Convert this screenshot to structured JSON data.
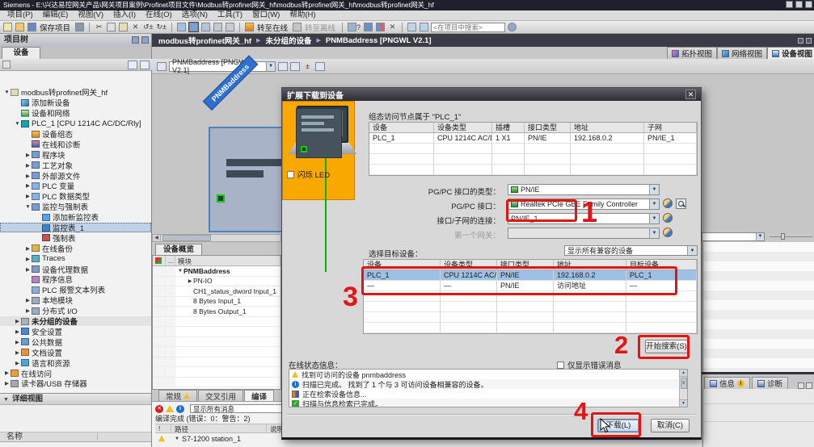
{
  "window": {
    "title": "Siemens  -  E:\\兴达易控网关产品\\网关项目案例\\Profinet项目文件\\Modbus转profinet网关_hf\\modbus转profinet网关_hf\\modbus转profinet网关_hf"
  },
  "menu_bar": {
    "items": [
      "项目(P)",
      "编辑(E)",
      "视图(V)",
      "插入(I)",
      "在线(O)",
      "选项(N)",
      "工具(T)",
      "窗口(W)",
      "帮助(H)"
    ]
  },
  "toolbar": {
    "save_label": "保存项目",
    "go_online_label": "转至在线",
    "go_offline_label": "转至离线",
    "search_placeholder": "<在项目中搜索>"
  },
  "breadcrumb": {
    "items": [
      "modbus转profinet网关_hf",
      "未分组的设备",
      "PNMBaddress [PNGWL V2.1]"
    ]
  },
  "project_tree": {
    "header": "项目树",
    "tab_label": "设备",
    "items": [
      {
        "arrow": "expanded",
        "icon": "project",
        "label": "modbus转profinet网关_hf",
        "depth": 0
      },
      {
        "arrow": "",
        "icon": "add-device",
        "label": "添加新设备",
        "depth": 1
      },
      {
        "arrow": "",
        "icon": "network",
        "label": "设备和网络",
        "depth": 1
      },
      {
        "arrow": "expanded",
        "icon": "plc",
        "label": "PLC_1 [CPU 1214C AC/DC/Rly]",
        "depth": 1
      },
      {
        "arrow": "",
        "icon": "config",
        "label": "设备组态",
        "depth": 2
      },
      {
        "arrow": "",
        "icon": "diagnostics",
        "label": "在线和诊断",
        "depth": 2
      },
      {
        "arrow": "collapsed",
        "icon": "folder",
        "label": "程序块",
        "depth": 2
      },
      {
        "arrow": "collapsed",
        "icon": "folder-tech",
        "label": "工艺对象",
        "depth": 2
      },
      {
        "arrow": "collapsed",
        "icon": "folder-src",
        "label": "外部源文件",
        "depth": 2
      },
      {
        "arrow": "collapsed",
        "icon": "tags",
        "label": "PLC 变量",
        "depth": 2
      },
      {
        "arrow": "collapsed",
        "icon": "types",
        "label": "PLC 数据类型",
        "depth": 2
      },
      {
        "arrow": "expanded",
        "icon": "folder-watch",
        "label": "监控与强制表",
        "depth": 2
      },
      {
        "arrow": "",
        "icon": "add-watch",
        "label": "添加新监控表",
        "depth": 3
      },
      {
        "arrow": "",
        "icon": "watch",
        "label": "监控表_1",
        "depth": 3,
        "selected": true
      },
      {
        "arrow": "",
        "icon": "force",
        "label": "强制表",
        "depth": 3
      },
      {
        "arrow": "collapsed",
        "icon": "backup",
        "label": "在线备份",
        "depth": 2
      },
      {
        "arrow": "collapsed",
        "icon": "traces",
        "label": "Traces",
        "depth": 2
      },
      {
        "arrow": "collapsed",
        "icon": "proxy",
        "label": "设备代理数据",
        "depth": 2
      },
      {
        "arrow": "",
        "icon": "program-info",
        "label": "程序信息",
        "depth": 2
      },
      {
        "arrow": "",
        "icon": "alarm-text",
        "label": "PLC 报警文本列表",
        "depth": 2
      },
      {
        "arrow": "collapsed",
        "icon": "local-modules",
        "label": "本地模块",
        "depth": 2
      },
      {
        "arrow": "collapsed",
        "icon": "distributed-io",
        "label": "分布式 I/O",
        "depth": 2
      },
      {
        "arrow": "collapsed",
        "icon": "ungrouped",
        "label": "未分组的设备",
        "depth": 1,
        "bold": true
      },
      {
        "arrow": "collapsed",
        "icon": "security",
        "label": "安全设置",
        "depth": 1
      },
      {
        "arrow": "collapsed",
        "icon": "common-data",
        "label": "公共数据",
        "depth": 1
      },
      {
        "arrow": "collapsed",
        "icon": "doc-settings",
        "label": "文档设置",
        "depth": 1
      },
      {
        "arrow": "collapsed",
        "icon": "languages",
        "label": "语言和资源",
        "depth": 1
      },
      {
        "arrow": "collapsed",
        "icon": "online-access",
        "label": "在线访问",
        "depth": 0
      },
      {
        "arrow": "collapsed",
        "icon": "card-reader",
        "label": "读卡器/USB 存储器",
        "depth": 0
      }
    ]
  },
  "detail_view": {
    "header": "详细视图",
    "name_column": "名称"
  },
  "editor": {
    "view_tabs": [
      "拓扑视图",
      "网络视图",
      "设备视图"
    ],
    "device_selector": "PNMBaddress [PNGWL V2.1]",
    "canvas_device_label": "PNMBaddress",
    "overview": {
      "tab_label": "设备概览",
      "module_column": "模块",
      "rows": [
        {
          "arrow": "expanded",
          "indent": 0,
          "label": "PNMBaddress",
          "bold": true
        },
        {
          "arrow": "collapsed",
          "indent": 1,
          "label": "PN-IO"
        },
        {
          "arrow": "",
          "indent": 1,
          "label": "CH1_status_dword Input_1"
        },
        {
          "arrow": "",
          "indent": 1,
          "label": "8 Bytes Input_1"
        },
        {
          "arrow": "",
          "indent": 1,
          "label": "8 Bytes Output_1"
        }
      ]
    }
  },
  "inspector": {
    "tabs": [
      "常规",
      "交叉引用",
      "编译"
    ],
    "filter_value": "显示所有消息",
    "status_text": "编译完成 (错误：0：警告：2)",
    "flag_column": "!",
    "path_column": "路径",
    "desc_column": "说明",
    "compile_row": "S7-1200 station_1"
  },
  "right_panel": {
    "info_tab": "信息",
    "diagnostics_tab": "诊断"
  },
  "dialog": {
    "title": "扩展下载到设备",
    "config_node_text": "组态访问节点属于 \"PLC_1\"",
    "configured_table": {
      "headers": [
        "设备",
        "设备类型",
        "插槽",
        "接口类型",
        "地址",
        "子网"
      ],
      "rows": [
        [
          "PLC_1",
          "CPU 1214C AC/D...",
          "1 X1",
          "PN/IE",
          "192.168.0.2",
          "PN/IE_1"
        ]
      ]
    },
    "pgpc_type_label": "PG/PC 接口的类型：",
    "pgpc_type_value": "PN/IE",
    "pgpc_if_label": "PG/PC 接口：",
    "pgpc_if_value": "Realtek PCIe GBE Family Controller",
    "subnet_label": "接口/子网的连接：",
    "subnet_value": "PN/IE_1",
    "gateway_label": "第一个网关：",
    "target_label": "选择目标设备：",
    "compat_filter_value": "显示所有兼容的设备",
    "target_table": {
      "headers": [
        "设备",
        "设备类型",
        "接口类型",
        "地址",
        "目标设备"
      ],
      "rows": [
        {
          "cells": [
            "PLC_1",
            "CPU 1214C AC/D...",
            "PN/IE",
            "192.168.0.2",
            "PLC_1"
          ],
          "selected": true
        },
        {
          "cells": [
            "—",
            "—",
            "PN/IE",
            "访问地址",
            "—"
          ],
          "selected": false
        }
      ]
    },
    "flash_led_label": "闪烁 LED",
    "start_search_label": "开始搜索(S)",
    "online_status_label": "在线状态信息：",
    "only_errors_label": "仅显示错误消息",
    "messages": [
      {
        "icon": "warning",
        "text": "找到可访问的设备 pnmbaddress"
      },
      {
        "icon": "info",
        "text": "扫描已完成。 找到了 1 个与 3 可访问设备相兼容的设备。"
      },
      {
        "icon": "busy",
        "text": "正在检索设备信息..."
      },
      {
        "icon": "ok",
        "text": "扫描与信息检索已完成。"
      }
    ],
    "download_label": "下载(L)",
    "cancel_label": "取消(C)"
  },
  "annotations": {
    "step1": "1",
    "step2": "2",
    "step3": "3",
    "step4": "4"
  },
  "colors": {
    "accent_orange": "#f8a800",
    "annotation_red": "#e21414",
    "selection_blue": "#9dc0e4",
    "online_green": "#00b400"
  }
}
